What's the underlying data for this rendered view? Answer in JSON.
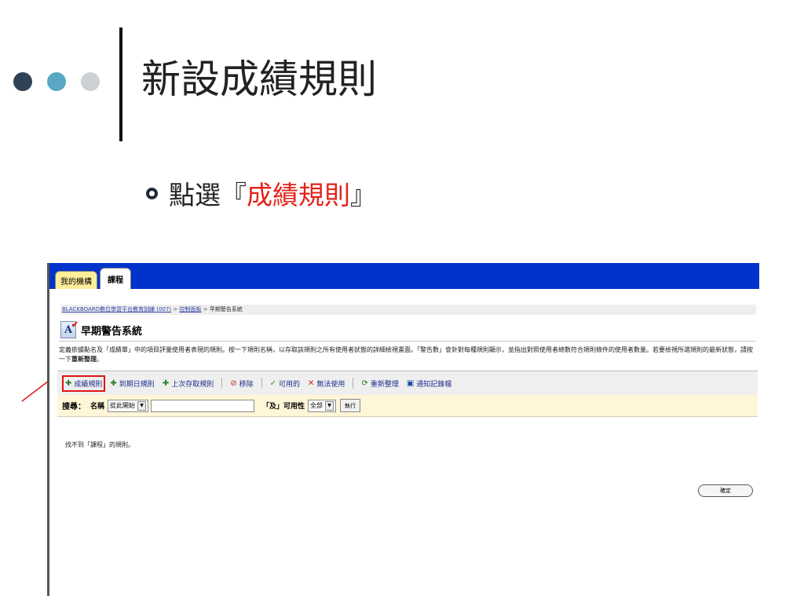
{
  "slide": {
    "title": "新設成績規則",
    "bullet_prefix": "點選『",
    "bullet_highlight": "成績規則",
    "bullet_suffix": "』",
    "colors": {
      "highlight": "#e2231a",
      "accent_dark": "#2e4456",
      "accent_light": "#5aa8c4"
    }
  },
  "app": {
    "tabs": {
      "mine": "我的機構",
      "course": "課程"
    },
    "breadcrumb": {
      "part1": "BLACKBOARD數位學習平台教育訓練 (007)",
      "sep1": " > ",
      "part2": "控制面板",
      "sep2": " > ",
      "current": "早期警告系統"
    },
    "page_title": "早期警告系統",
    "description_a": "定義依據點名及「成績單」中的項目評量使用者表現的規則。按一下規則名稱，以存取該規則之所有使用者狀態的詳細檢視畫面。「警告數」會針對每種規則顯示，並指出對照使用者總數符合規則條件的使用者數量。若要檢視所選規則的最新狀態，請按一下",
    "description_bold": "重新整理",
    "description_end": "。",
    "toolbar": {
      "grade_rule": "成績規則",
      "due_date_rule": "到期日規則",
      "last_access_rule": "上次存取規則",
      "remove": "移除",
      "available": "可用的",
      "unavailable": "無法使用",
      "refresh": "重新整理",
      "notify_log": "通知記錄檔"
    },
    "search": {
      "label": "搜尋：",
      "name_label": "名稱",
      "name_mode": "從此開始",
      "and_label": "「及」可用性",
      "availability": "全部",
      "go": "執行"
    },
    "not_found": "找不到「課程」的規則。",
    "ok": "確定"
  }
}
